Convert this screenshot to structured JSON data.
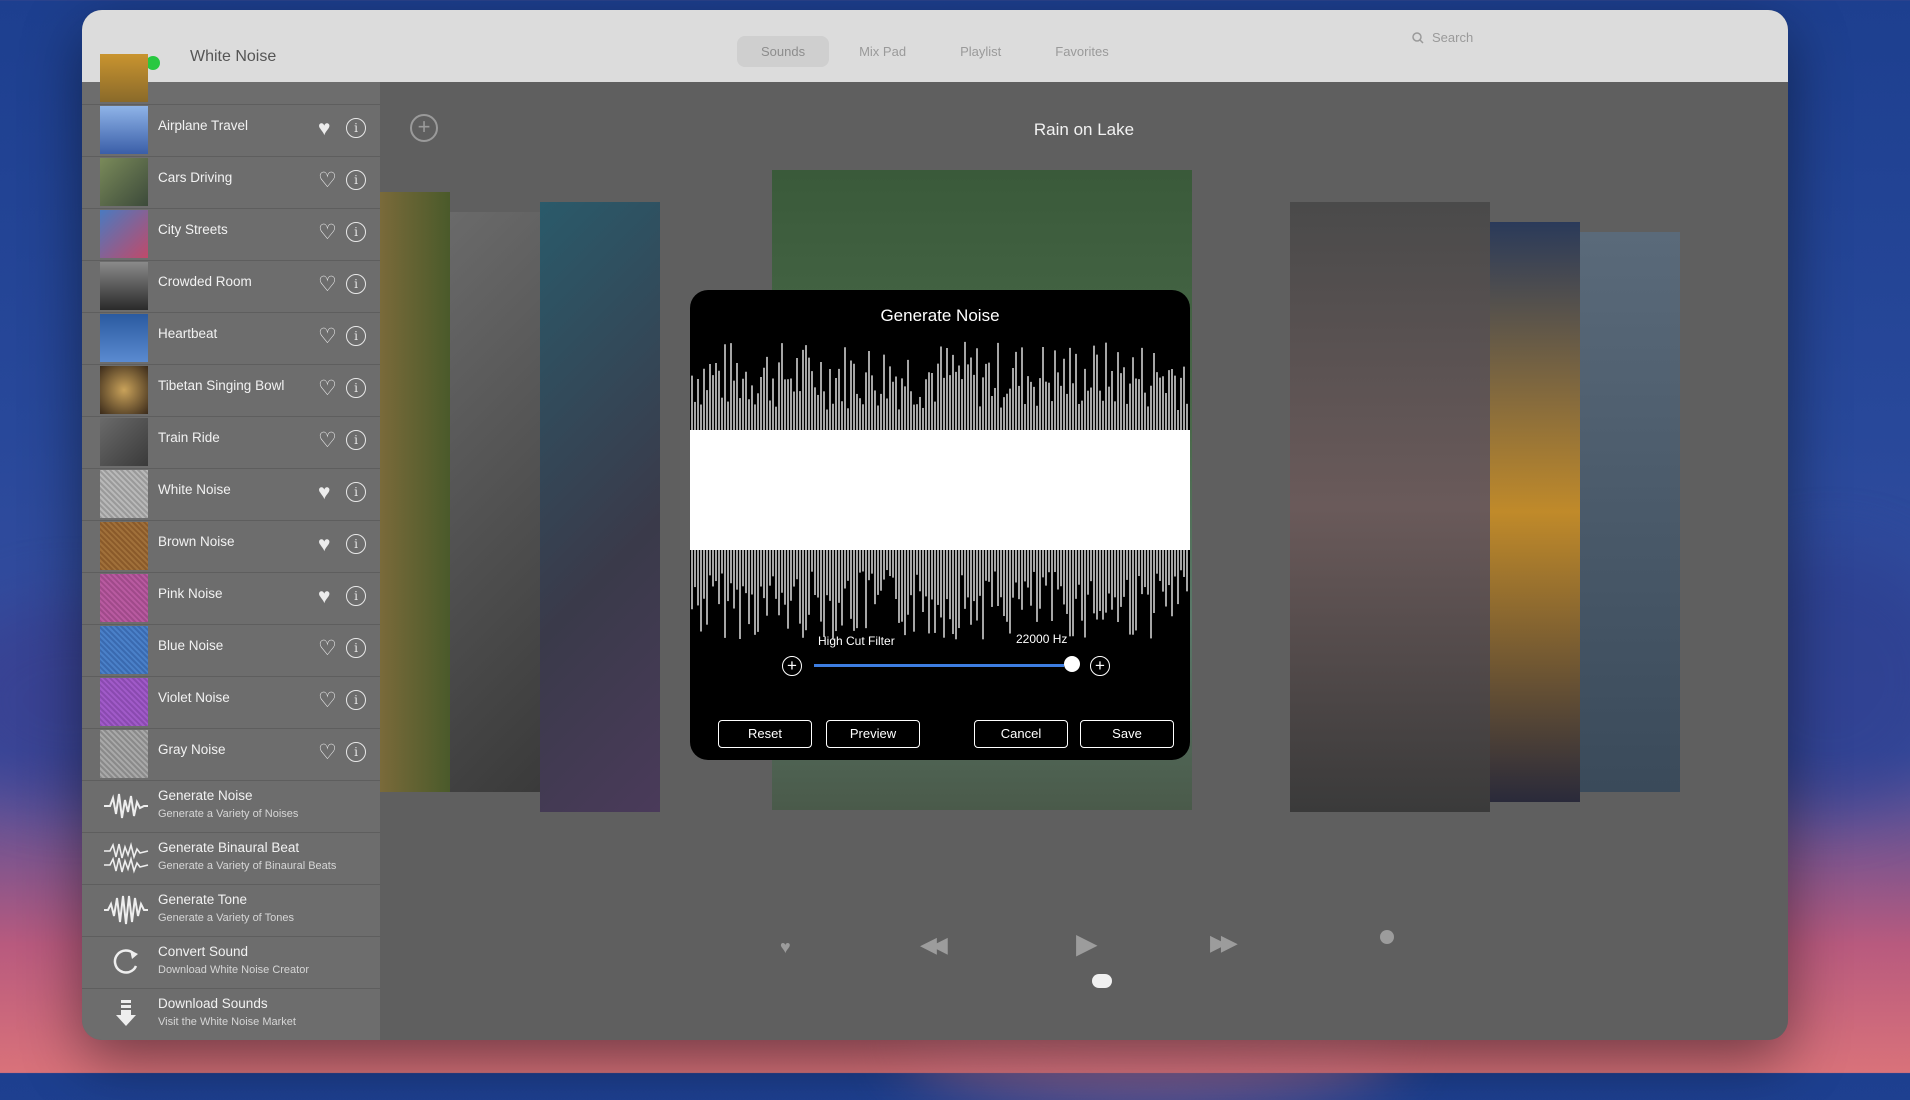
{
  "window": {
    "title": "White Noise",
    "tabs": [
      "Sounds",
      "Mix Pad",
      "Playlist",
      "Favorites"
    ],
    "search_placeholder": "Search"
  },
  "sidebar": {
    "items": [
      {
        "label": "Airplane Travel",
        "favorite": true
      },
      {
        "label": "Cars Driving",
        "favorite": false
      },
      {
        "label": "City Streets",
        "favorite": false
      },
      {
        "label": "Crowded Room",
        "favorite": false
      },
      {
        "label": "Heartbeat",
        "favorite": false
      },
      {
        "label": "Tibetan Singing Bowl",
        "favorite": false
      },
      {
        "label": "Train Ride",
        "favorite": false
      },
      {
        "label": "White Noise",
        "favorite": true
      },
      {
        "label": "Brown Noise",
        "favorite": true
      },
      {
        "label": "Pink Noise",
        "favorite": true
      },
      {
        "label": "Blue Noise",
        "favorite": false
      },
      {
        "label": "Violet Noise",
        "favorite": false
      },
      {
        "label": "Gray Noise",
        "favorite": false
      }
    ],
    "generators": [
      {
        "title": "Generate Noise",
        "subtitle": "Generate a Variety of Noises",
        "icon": "waveform-icon"
      },
      {
        "title": "Generate Binaural Beat",
        "subtitle": "Generate a Variety of Binaural Beats",
        "icon": "binaural-waveform-icon"
      },
      {
        "title": "Generate Tone",
        "subtitle": "Generate a Variety of Tones",
        "icon": "tone-waveform-icon"
      },
      {
        "title": "Convert Sound",
        "subtitle": "Download White Noise Creator",
        "icon": "convert-icon"
      },
      {
        "title": "Download Sounds",
        "subtitle": "Visit the White Noise Market",
        "icon": "download-icon"
      }
    ]
  },
  "main": {
    "now_playing": "Rain on Lake"
  },
  "dialog": {
    "title": "Generate Noise",
    "filter_label": "High Cut Filter",
    "filter_value": "22000 Hz",
    "buttons": {
      "reset": "Reset",
      "preview": "Preview",
      "cancel": "Cancel",
      "save": "Save"
    }
  },
  "colors": {
    "slider_accent": "#3d7de0",
    "traffic_close": "#ff5f57",
    "traffic_min": "#febc2e",
    "traffic_max": "#28c840"
  }
}
